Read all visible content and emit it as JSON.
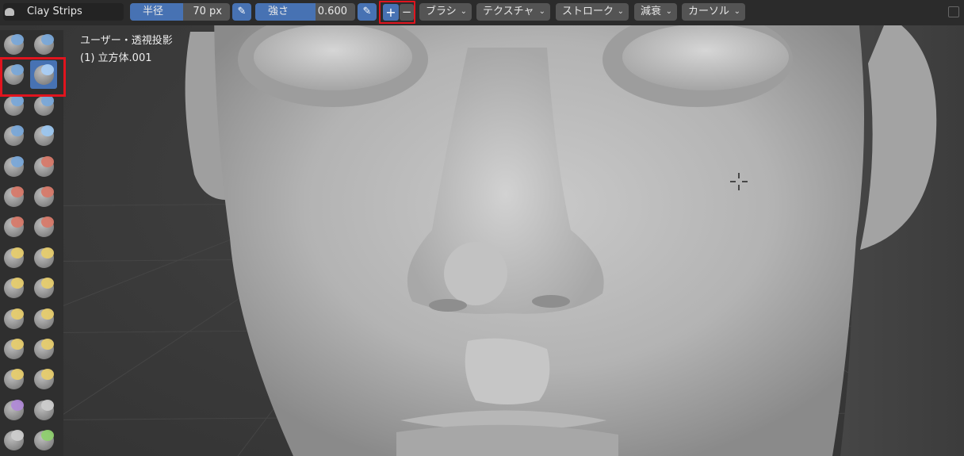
{
  "header": {
    "brush_name": "Clay Strips",
    "radius": {
      "label": "半径",
      "value": "70 px",
      "fill_fraction": 0.53
    },
    "strength": {
      "label": "強さ",
      "value": "0.600",
      "fill_fraction": 0.6
    },
    "plus_label": "+",
    "minus_label": "−",
    "menus": [
      {
        "label": "ブラシ"
      },
      {
        "label": "テクスチャ"
      },
      {
        "label": "ストローク"
      },
      {
        "label": "減衰"
      },
      {
        "label": "カーソル"
      }
    ]
  },
  "viewport": {
    "view_label": "ユーザー・透視投影",
    "object_label": "(1) 立方体.001"
  },
  "toolbar": {
    "tools": [
      {
        "name": "draw",
        "color": "#7aa8d8",
        "active": false
      },
      {
        "name": "draw-sharp",
        "color": "#7aa8d8",
        "active": false
      },
      {
        "name": "clay",
        "color": "#7aa8d8",
        "active": false
      },
      {
        "name": "clay-strips",
        "color": "#a9cdf5",
        "active": true
      },
      {
        "name": "clay-thumb",
        "color": "#7aa8d8",
        "active": false
      },
      {
        "name": "layer",
        "color": "#7aa8d8",
        "active": false
      },
      {
        "name": "inflate",
        "color": "#7aa8d8",
        "active": false
      },
      {
        "name": "blob",
        "color": "#9cc6ee",
        "active": false
      },
      {
        "name": "crease",
        "color": "#7aa8d8",
        "active": false
      },
      {
        "name": "smooth",
        "color": "#d77a6a",
        "active": false
      },
      {
        "name": "flatten",
        "color": "#d77a6a",
        "active": false
      },
      {
        "name": "fill",
        "color": "#d77a6a",
        "active": false
      },
      {
        "name": "scrape",
        "color": "#d77a6a",
        "active": false
      },
      {
        "name": "multiplane-scrape",
        "color": "#d77a6a",
        "active": false
      },
      {
        "name": "pinch",
        "color": "#e6cc6e",
        "active": false
      },
      {
        "name": "grab",
        "color": "#e6cc6e",
        "active": false
      },
      {
        "name": "elastic-deform",
        "color": "#e6cc6e",
        "active": false
      },
      {
        "name": "snake-hook",
        "color": "#e6cc6e",
        "active": false
      },
      {
        "name": "thumb",
        "color": "#e6cc6e",
        "active": false
      },
      {
        "name": "pose",
        "color": "#e6cc6e",
        "active": false
      },
      {
        "name": "nudge",
        "color": "#e6cc6e",
        "active": false
      },
      {
        "name": "rotate",
        "color": "#e6cc6e",
        "active": false
      },
      {
        "name": "slide-relax",
        "color": "#e6cc6e",
        "active": false
      },
      {
        "name": "boundary",
        "color": "#e6cc6e",
        "active": false
      },
      {
        "name": "cloth",
        "color": "#b08ad6",
        "active": false
      },
      {
        "name": "simplify",
        "color": "#cccccc",
        "active": false
      },
      {
        "name": "mask",
        "color": "#cccccc",
        "active": false
      },
      {
        "name": "draw-face-sets",
        "color": "#8fcf6f",
        "active": false
      }
    ]
  },
  "colors": {
    "accent": "#4772b3",
    "highlight_box": "#e0141e",
    "header_bg": "#2b2b2b",
    "viewport_bg": "#3a3a3a"
  }
}
